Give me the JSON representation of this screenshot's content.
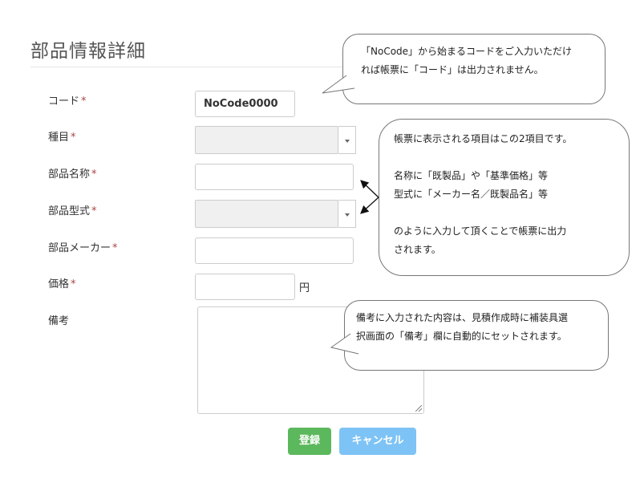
{
  "page": {
    "title": "部品情報詳細",
    "required_mark": "*"
  },
  "form": {
    "code": {
      "label": "コード",
      "value": "NoCode0000"
    },
    "category": {
      "label": "種目",
      "value": ""
    },
    "part_name": {
      "label": "部品名称",
      "value": ""
    },
    "part_model": {
      "label": "部品型式",
      "value": ""
    },
    "part_maker": {
      "label": "部品メーカー",
      "value": ""
    },
    "price": {
      "label": "価格",
      "value": "",
      "unit": "円"
    },
    "remarks": {
      "label": "備考",
      "value": ""
    }
  },
  "buttons": {
    "register": "登録",
    "cancel": "キャンセル"
  },
  "callouts": {
    "code_note": {
      "lines": [
        "「NoCode」から始まるコードをご入力いただけ",
        "れば帳票に「コード」は出力されません。"
      ]
    },
    "report_note": {
      "lines": [
        "帳票に表示される項目はこの2項目です。",
        "",
        "名称に「既製品」や「基準価格」等",
        "型式に「メーカー名／既製品名」等",
        "",
        "のように入力して頂くことで帳票に出力",
        "されます。"
      ]
    },
    "remarks_note": {
      "lines": [
        "備考に入力された内容は、見積作成時に補装具選",
        "択画面の「備考」欄に自動的にセットされます。"
      ]
    }
  },
  "colors": {
    "required": "#a94442",
    "register_button": "#5cb85c",
    "cancel_button": "#7ec3f5"
  }
}
